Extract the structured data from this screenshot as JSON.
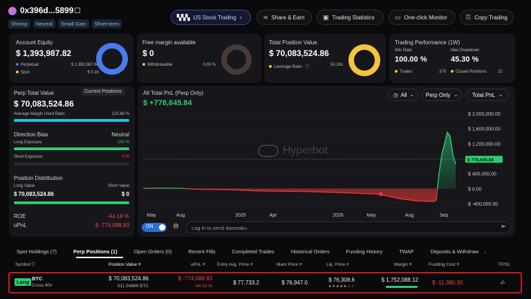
{
  "header": {
    "address": "0x396d...5899",
    "tags": [
      "Shrimp",
      "Neutral",
      "Small Gain",
      "Short-term"
    ],
    "buttons": {
      "us_stock": "US Stock Trading",
      "share": "Share & Earn",
      "stats": "Trading Statistics",
      "monitor": "One-click Monitor",
      "copy": "Copy Trading"
    }
  },
  "account_equity": {
    "label": "Account Equity",
    "value": "$ 1,393,987.82",
    "perpetual_label": "Perpetual",
    "perpetual_value": "$ 1,393,987.66",
    "spot_label": "Spot",
    "spot_value": "$ 0.16"
  },
  "free_margin": {
    "label": "Free margin available",
    "value": "$ 0",
    "withdrawable_label": "Withdrawable",
    "withdrawable_value": "0.00 %"
  },
  "total_position": {
    "label": "Total Position Value",
    "value": "$ 70,083,524.86",
    "leverage_label": "Leverage Ratio",
    "leverage_value": "50.28x"
  },
  "performance": {
    "label": "Trading Performance (1W)",
    "win_rate_label": "Win Rate",
    "win_rate_value": "100.00 %",
    "drawdown_label": "Max Drawdown",
    "drawdown_value": "45.30 %",
    "trades_label": "Trades",
    "trades_value": "375",
    "closed_label": "Closed Positions",
    "closed_value": "21"
  },
  "perp_panel": {
    "title": "Perp Total Value",
    "current_positions_btn": "Current Positions",
    "value": "$ 70,083,524.86",
    "margin_ratio_label": "Average Margin Used Ratio",
    "margin_ratio_value": "125.69 %",
    "margin_ratio_fill": 1.0,
    "direction_bias_label": "Direction Bias",
    "direction_bias_value": "Neutral",
    "long_exposure_label": "Long Exposure",
    "long_exposure_value": "100 %",
    "long_exposure_fill": 1.0,
    "short_exposure_label": "Short Exposure",
    "short_exposure_value": "0 %",
    "short_exposure_fill": 0,
    "distribution_label": "Position Distribution",
    "long_value_label": "Long Value",
    "long_value": "$ 70,083,524.86",
    "short_value_label": "Short Value",
    "short_value": "$ 0",
    "roe_label": "ROE",
    "roe_value": "-44.18 %",
    "upnl_label": "uPnL",
    "upnl_value": "$ -774,088.93"
  },
  "pnl_chart": {
    "title": "All Total PnL (Perp Only)",
    "value": "$ +778,645.84",
    "filters": [
      "All",
      "Perp Only",
      "Total PnL"
    ],
    "watermark": "Hyperbot",
    "current_label": "$ 778,645.84",
    "danmaku_toggle": "ON",
    "danmaku_placeholder": "Log in to send danmaku"
  },
  "chart_data": {
    "type": "area",
    "title": "All Total PnL (Perp Only)",
    "x_labels": [
      "May",
      "Aug",
      "2025",
      "Apr",
      "2026",
      "May",
      "Aug",
      "Sep"
    ],
    "y_ticks": [
      "$ 2,000,000.00",
      "$ 1,600,000.00",
      "$ 1,200,000.00",
      "$ 800,000.00",
      "$ 400,000.00",
      "$ 0.00",
      "$ -400,000.00"
    ],
    "ylim": [
      -400000,
      2000000
    ],
    "series": [
      {
        "values": [
          0,
          10000,
          5000,
          -20000,
          -25000,
          -35000,
          -60000,
          -70000,
          -75000,
          -80000,
          -95000,
          -110000,
          -130000,
          -150000,
          -260000,
          -330000,
          -350000,
          -310000,
          400000,
          900000,
          1200000,
          1500000,
          1400000,
          900000,
          650000
        ]
      }
    ]
  },
  "tabs": [
    "Spot Holdings (7)",
    "Perp Positions (1)",
    "Open Orders (0)",
    "Recent Fills",
    "Completed Trades",
    "Historical Orders",
    "Funding History",
    "TWAP",
    "Deposits & Withdraw"
  ],
  "table": {
    "headers": [
      "Symbol",
      "Position Value",
      "uPnL",
      "Entry Avg. Price",
      "Mark Price",
      "Liq. Price",
      "Margin",
      "Funding Cost",
      "TP/SL"
    ],
    "row": {
      "side": "Long",
      "symbol": "BTC",
      "leverage": "Cross 40x",
      "position_value": "$ 70,083,524.86",
      "position_size": "911.54889 BTC",
      "upnl": "$ -774,088.93",
      "upnl_pct": "-44.18 %",
      "entry": "$ 77,733.2",
      "mark": "$ 76,947.0",
      "liq": "$ 76,308.6",
      "margin": "$ 1,752,088.12",
      "funding": "$ -11,380.30",
      "tpsl": "-/-"
    }
  },
  "colors": {
    "accent_blue": "#4a7cf0",
    "gold": "#f2c440",
    "green": "#2ecc71",
    "red": "#e53935",
    "cyan": "#1fc6e0"
  }
}
